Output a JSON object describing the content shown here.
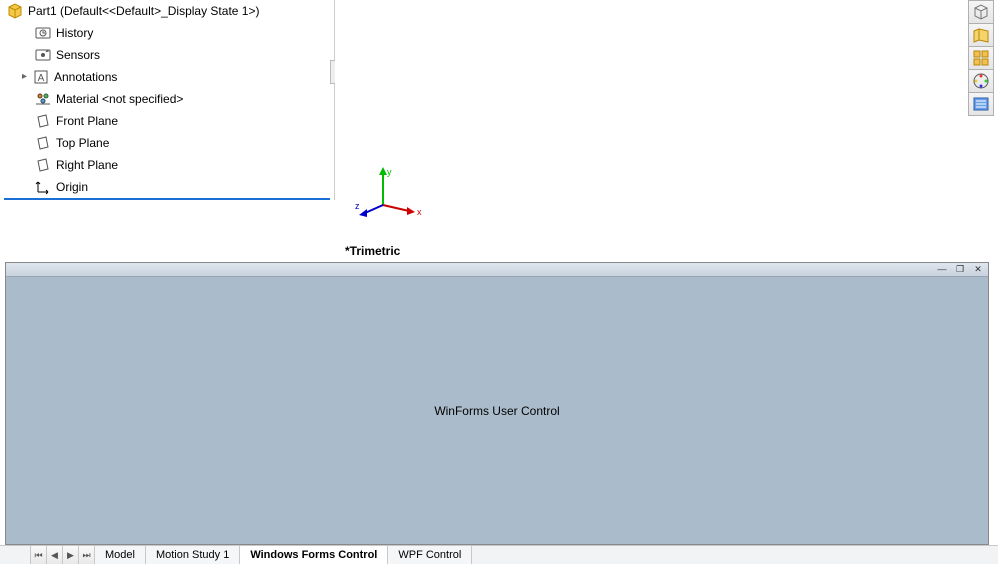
{
  "tree": {
    "root_label": "Part1  (Default<<Default>_Display State 1>)",
    "items": [
      {
        "label": "History"
      },
      {
        "label": "Sensors"
      },
      {
        "label": "Annotations",
        "expandable": true
      },
      {
        "label": "Material <not specified>"
      },
      {
        "label": "Front Plane"
      },
      {
        "label": "Top Plane"
      },
      {
        "label": "Right Plane"
      },
      {
        "label": "Origin"
      }
    ]
  },
  "viewport": {
    "orientation_label": "*Trimetric",
    "axes": {
      "x": "x",
      "y": "y",
      "z": "z"
    }
  },
  "taskpane": {
    "body_text": "WinForms User Control"
  },
  "bottom_tabs": {
    "tabs": [
      {
        "label": "Model",
        "active": false
      },
      {
        "label": "Motion Study 1",
        "active": false
      },
      {
        "label": "Windows Forms Control",
        "active": true
      },
      {
        "label": "WPF Control",
        "active": false
      }
    ]
  },
  "right_toolbar": {
    "buttons": [
      "sw-resources",
      "design-library",
      "file-explorer",
      "appearances",
      "custom-props"
    ]
  }
}
